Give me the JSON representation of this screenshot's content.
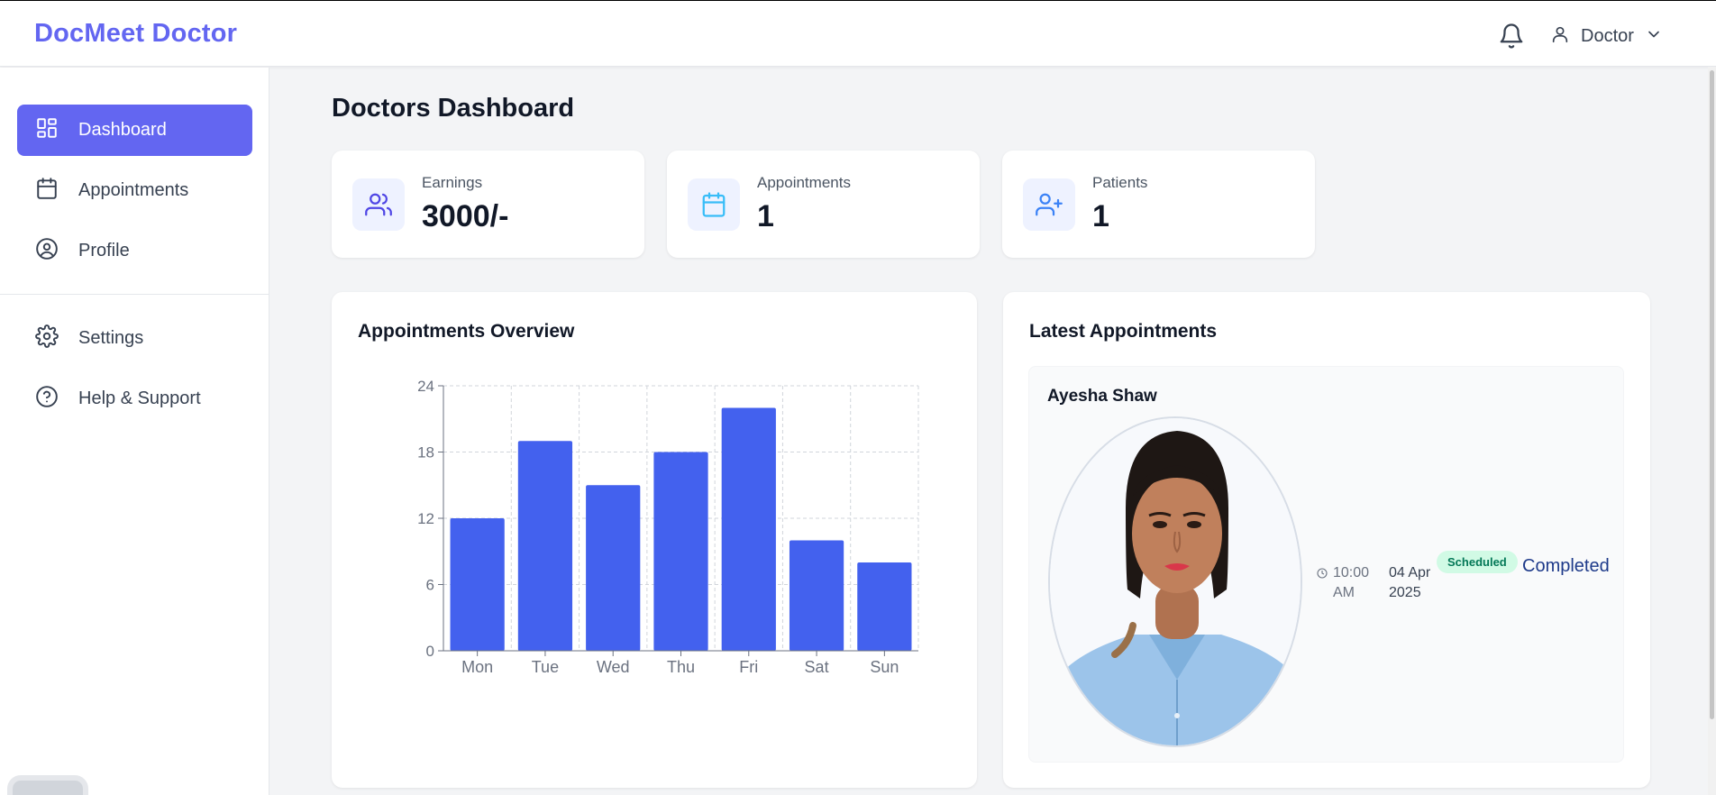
{
  "header": {
    "brand": "DocMeet Doctor",
    "icons": {
      "notifications": "bell-icon",
      "user": "user-icon",
      "dropdown": "chevron-down-icon"
    },
    "user_name": "Doctor"
  },
  "sidebar": {
    "items": [
      {
        "label": "Dashboard",
        "icon": "grid-icon",
        "active": true
      },
      {
        "label": "Appointments",
        "icon": "calendar-icon",
        "active": false
      },
      {
        "label": "Profile",
        "icon": "user-circle-icon",
        "active": false
      }
    ],
    "secondary_items": [
      {
        "label": "Settings",
        "icon": "gear-icon"
      },
      {
        "label": "Help & Support",
        "icon": "help-circle-icon"
      }
    ]
  },
  "main": {
    "title": "Doctors Dashboard",
    "stats": [
      {
        "label": "Earnings",
        "value": "3000/-",
        "icon": "users-icon"
      },
      {
        "label": "Appointments",
        "value": "1",
        "icon": "calendar-icon"
      },
      {
        "label": "Patients",
        "value": "1",
        "icon": "user-plus-icon"
      }
    ],
    "overview_title": "Appointments Overview",
    "latest_title": "Latest Appointments",
    "latest": [
      {
        "patient_name": "Ayesha Shaw",
        "time_line1": "10:00",
        "time_line2": "AM",
        "date_line1": "04 Apr",
        "date_line2": "2025",
        "badge": "Scheduled",
        "status": "Completed"
      }
    ]
  },
  "colors": {
    "accent": "#6366f1",
    "bar": "#4361ee",
    "badge_bg": "#d1fae5",
    "badge_text": "#047857"
  },
  "chart_data": {
    "type": "bar",
    "categories": [
      "Mon",
      "Tue",
      "Wed",
      "Thu",
      "Fri",
      "Sat",
      "Sun"
    ],
    "values": [
      12,
      19,
      15,
      18,
      22,
      10,
      8
    ],
    "yticks": [
      0,
      6,
      12,
      18,
      24
    ],
    "ylim": [
      0,
      24
    ],
    "grid": true,
    "legend": "none"
  }
}
